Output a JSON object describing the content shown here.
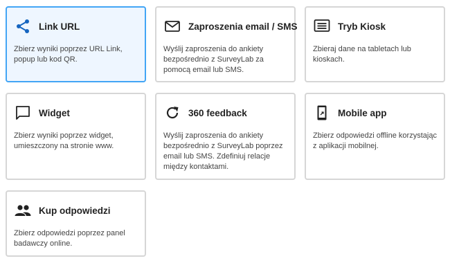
{
  "cards": [
    {
      "title": "Link URL",
      "desc": "Zbierz wyniki poprzez URL Link, popup lub kod QR.",
      "icon": "share-icon",
      "selected": true
    },
    {
      "title": "Zaproszenia email / SMS",
      "desc": "Wyślij zaproszenia do ankiety bezpośrednio z SurveyLab za pomocą email lub SMS.",
      "icon": "envelope-icon"
    },
    {
      "title": "Tryb Kiosk",
      "desc": "Zbieraj dane na tabletach lub kioskach.",
      "icon": "kiosk-icon"
    },
    {
      "title": "Widget",
      "desc": "Zbierz wyniki poprzez widget, umieszczony na stronie www.",
      "icon": "chat-bubble-icon"
    },
    {
      "title": "360 feedback",
      "desc": "Wyślij zaproszenia do ankiety bezpośrednio z SurveyLab poprzez email lub SMS. Zdefiniuj relacje między kontaktami.",
      "icon": "refresh-icon"
    },
    {
      "title": "Mobile app",
      "desc": "Zbierz odpowiedzi offline korzystając z aplikacji mobilnej.",
      "icon": "mobile-phone-icon"
    },
    {
      "title": "Kup odpowiedzi",
      "desc": "Zbierz odpowiedzi poprzez panel badawczy online.",
      "icon": "people-icon"
    }
  ],
  "colors": {
    "accent": "#1565c0",
    "selected_border": "#42a5f5",
    "selected_background": "#eef6ff",
    "card_border": "#d6d6d6"
  }
}
